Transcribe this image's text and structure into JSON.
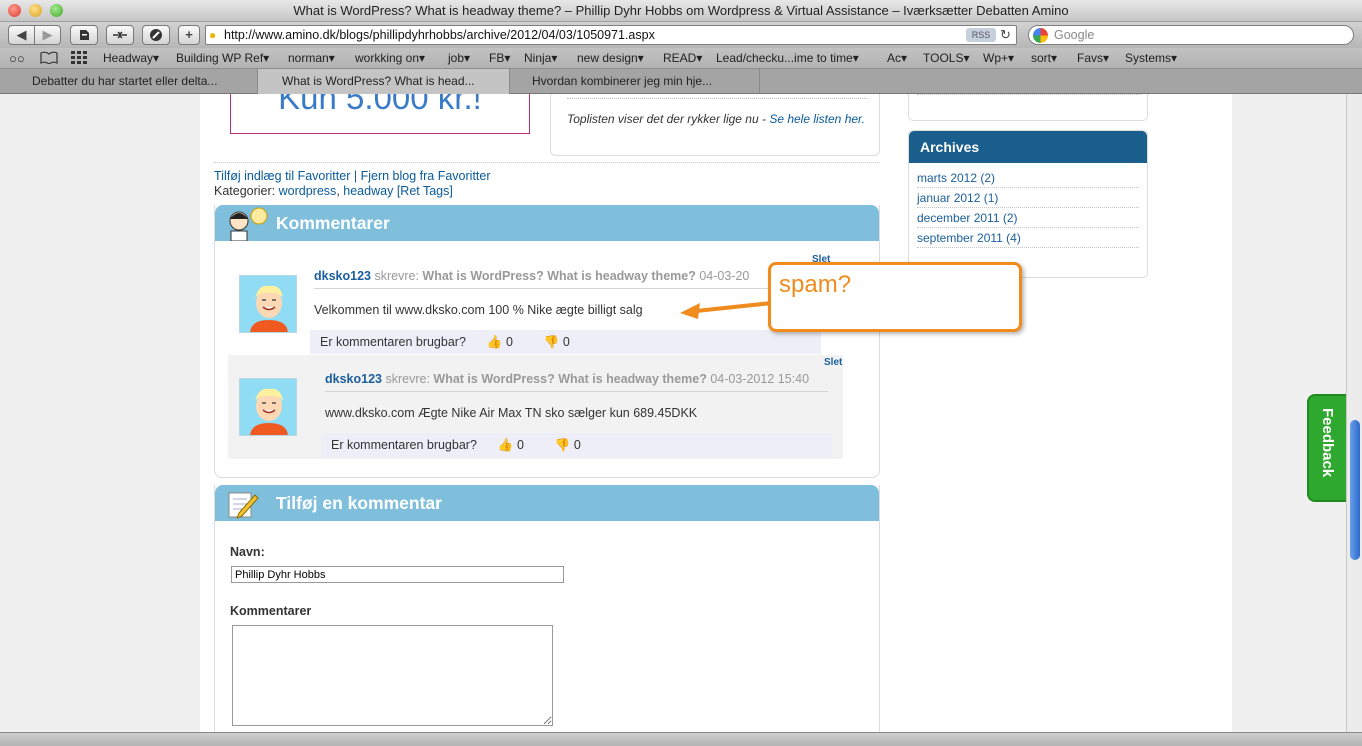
{
  "window": {
    "title": "What is WordPress? What is headway theme? – Phillip Dyhr Hobbs om Wordpress & Virtual Assistance – Iværksætter Debatten Amino"
  },
  "toolbar": {
    "url": "http://www.amino.dk/blogs/phillipdyhrhobbs/archive/2012/04/03/1050971.aspx",
    "rss": "RSS",
    "search_placeholder": "Google"
  },
  "bookmarks": [
    "Headway▾",
    "Building WP Ref▾",
    "norman▾",
    "workking on▾",
    "job▾",
    "FB▾",
    "Ninja▾",
    "new design▾",
    "READ▾",
    "Lead/checku...ime to time▾",
    "Ac▾",
    "TOOLS▾",
    "Wp+▾",
    "sort▾",
    "Favs▾",
    "Systems▾"
  ],
  "tabs": [
    {
      "label": "Debatter du har startet eller delta..."
    },
    {
      "label": "What is WordPress? What is head..."
    },
    {
      "label": "Hvordan kombinerer jeg min hje..."
    }
  ],
  "banner": {
    "text": "Kun 5.000 kr.!"
  },
  "toplist": {
    "text": "Toplisten viser det der rykker lige nu - ",
    "link": "Se hele listen her."
  },
  "post_links": {
    "fav_add": "Tilføj indlæg til Favoritter",
    "sep": "|",
    "fav_remove": "Fjern blog fra Favoritter",
    "categories_label": "Kategorier:",
    "cat1": "wordpress",
    "comma": ",",
    "cat2": "headway",
    "ret_tags": "[Ret Tags]"
  },
  "comments": {
    "header": "Kommentarer",
    "items": [
      {
        "user": "dksko123",
        "wrote": "skrevre:",
        "post": "What is WordPress? What is headway theme?",
        "date": "04-03-20",
        "text": "Velkommen til www.dksko.com 100 % Nike ægte billigt salg",
        "question": "Er kommentaren brugbar?",
        "up": "0",
        "down": "0",
        "delete": "Slet"
      },
      {
        "user": "dksko123",
        "wrote": "skrevre:",
        "post": "What is WordPress? What is headway theme?",
        "date": "04-03-2012 15:40",
        "text": "www.dksko.com Ægte Nike Air Max TN sko sælger kun 689.45DKK",
        "question": "Er kommentaren brugbar?",
        "up": "0",
        "down": "0",
        "delete": "Slet"
      }
    ]
  },
  "callout": {
    "text": "spam?",
    "color": "#f08c1e"
  },
  "add_comment": {
    "header": "Tilføj en kommentar",
    "name_label": "Navn:",
    "name_value": "Phillip Dyhr Hobbs",
    "comment_label": "Kommentarer"
  },
  "sidebar": {
    "archives_title": "Archives",
    "archives": [
      "marts 2012 (2)",
      "januar 2012 (1)",
      "december 2011 (2)",
      "september 2011 (4)"
    ]
  },
  "feedback": {
    "label": "Feedback",
    "color": "#2fa82f"
  }
}
